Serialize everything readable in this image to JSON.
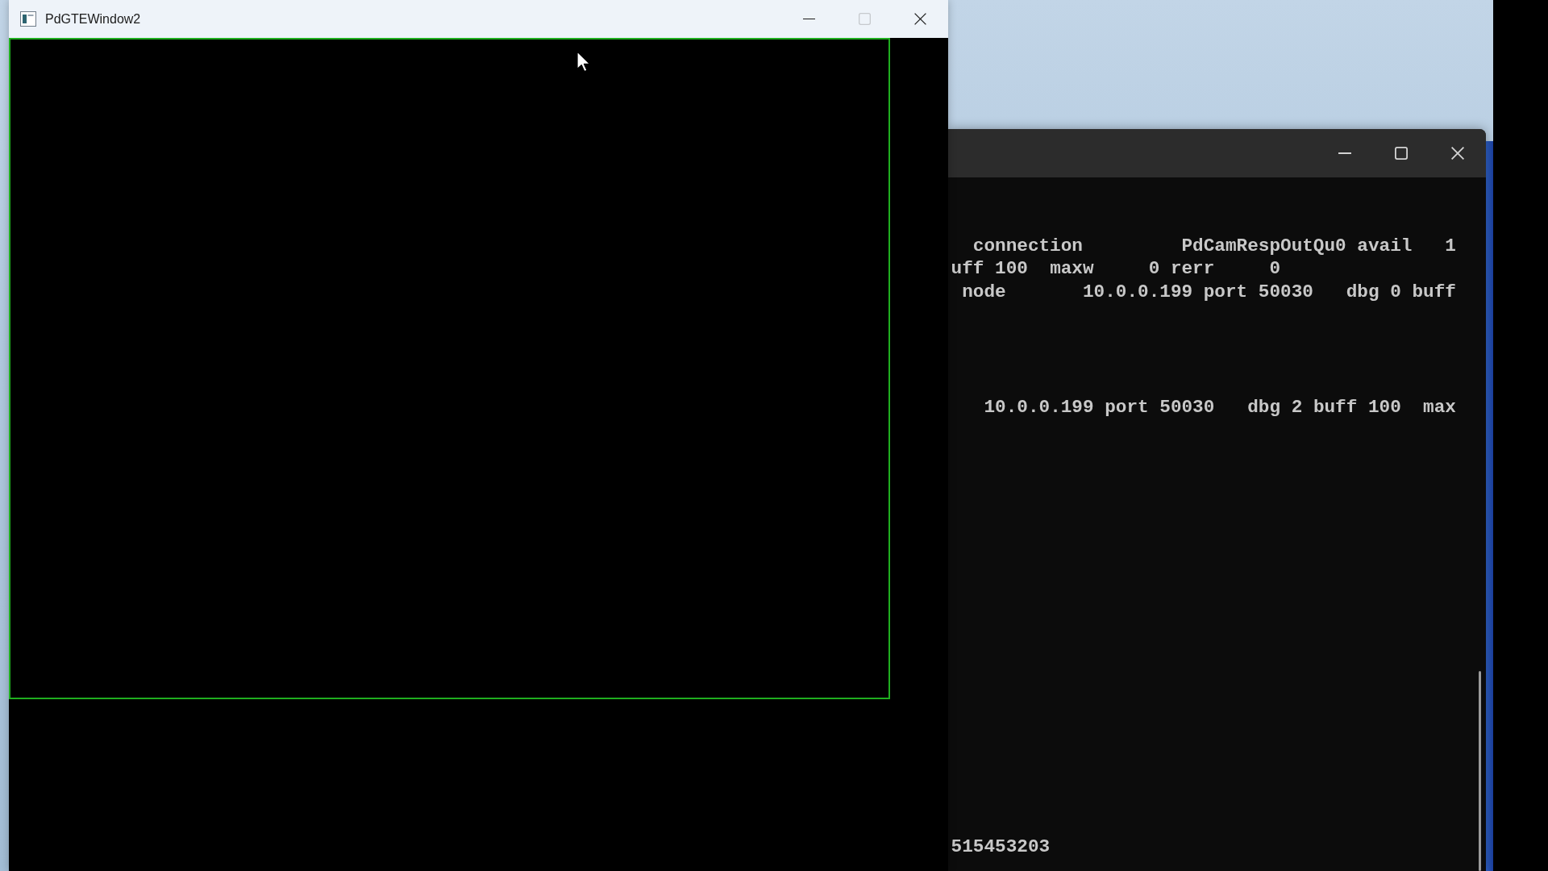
{
  "app_window": {
    "title": "PdGTEWindow2",
    "buttons": [
      {
        "kind": "minimize",
        "disabled": false
      },
      {
        "kind": "maximize",
        "disabled": true
      },
      {
        "kind": "close",
        "disabled": false
      }
    ]
  },
  "terminal_window": {
    "buttons": [
      {
        "kind": "minimize"
      },
      {
        "kind": "maximize"
      },
      {
        "kind": "close"
      }
    ],
    "output": [
      "connection         PdCamRespOutQu0 avail   1",
      "uff 100  maxw     0 rerr     0",
      "node       10.0.0.199 port 50030   dbg 0 buff",
      "10.0.0.199 port 50030   dbg 2 buff 100  max",
      "515453203"
    ]
  }
}
